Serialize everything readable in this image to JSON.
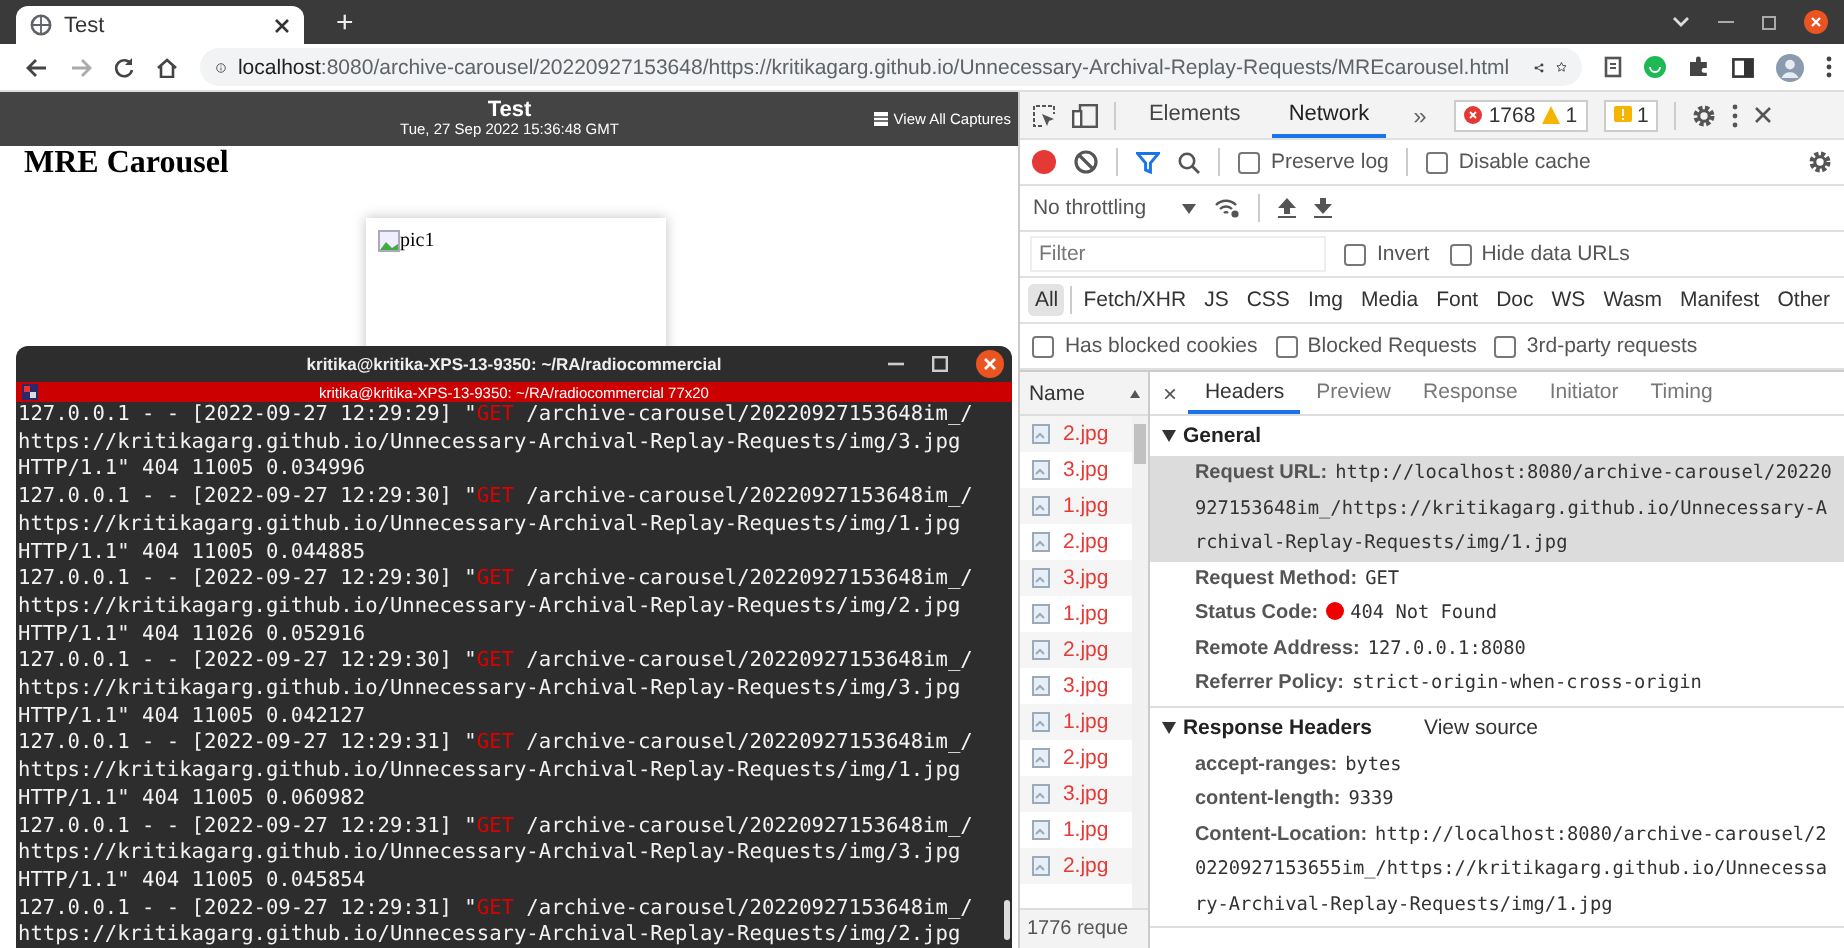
{
  "browser": {
    "tab": {
      "title": "Test"
    },
    "new_tab": "+",
    "address": {
      "host": "localhost",
      "path": ":8080/archive-carousel/20220927153648/https://kritikagarg.github.io/Unnecessary-Archival-Replay-Requests/MREcarousel.html"
    }
  },
  "page": {
    "banner": {
      "title": "Test",
      "date": "Tue, 27 Sep 2022 15:36:48 GMT",
      "link": "View All Captures"
    },
    "heading": "MRE Carousel",
    "image_alt": "pic1"
  },
  "terminal": {
    "title": "kritika@kritika-XPS-13-9350: ~/RA/radiocommercial",
    "subtitle": "kritika@kritika-XPS-13-9350: ~/RA/radiocommercial 77x20",
    "entries": [
      {
        "start": "127.0.0.1 - - [2022-09-27 12:29:29] \"",
        "method": "GET",
        "rest": " /archive-carousel/20220927153648im_/",
        "url": "https://kritikagarg.github.io/Unnecessary-Archival-Replay-Requests/img/3.jpg",
        "tail": "HTTP/1.1\" 404 11005 0.034996"
      },
      {
        "start": "127.0.0.1 - - [2022-09-27 12:29:30] \"",
        "method": "GET",
        "rest": " /archive-carousel/20220927153648im_/",
        "url": "https://kritikagarg.github.io/Unnecessary-Archival-Replay-Requests/img/1.jpg",
        "tail": "HTTP/1.1\" 404 11005 0.044885"
      },
      {
        "start": "127.0.0.1 - - [2022-09-27 12:29:30] \"",
        "method": "GET",
        "rest": " /archive-carousel/20220927153648im_/",
        "url": "https://kritikagarg.github.io/Unnecessary-Archival-Replay-Requests/img/2.jpg",
        "tail": "HTTP/1.1\" 404 11026 0.052916"
      },
      {
        "start": "127.0.0.1 - - [2022-09-27 12:29:30] \"",
        "method": "GET",
        "rest": " /archive-carousel/20220927153648im_/",
        "url": "https://kritikagarg.github.io/Unnecessary-Archival-Replay-Requests/img/3.jpg",
        "tail": "HTTP/1.1\" 404 11005 0.042127"
      },
      {
        "start": "127.0.0.1 - - [2022-09-27 12:29:31] \"",
        "method": "GET",
        "rest": " /archive-carousel/20220927153648im_/",
        "url": "https://kritikagarg.github.io/Unnecessary-Archival-Replay-Requests/img/1.jpg",
        "tail": "HTTP/1.1\" 404 11005 0.060982"
      },
      {
        "start": "127.0.0.1 - - [2022-09-27 12:29:31] \"",
        "method": "GET",
        "rest": " /archive-carousel/20220927153648im_/",
        "url": "https://kritikagarg.github.io/Unnecessary-Archival-Replay-Requests/img/3.jpg",
        "tail": "HTTP/1.1\" 404 11005 0.045854"
      },
      {
        "start": "127.0.0.1 - - [2022-09-27 12:29:31] \"",
        "method": "GET",
        "rest": " /archive-carousel/20220927153648im_/",
        "url": "https://kritikagarg.github.io/Unnecessary-Archival-Replay-Requests/img/2.jpg"
      }
    ]
  },
  "devtools": {
    "panel_tabs": [
      {
        "label": "Elements",
        "selected": false
      },
      {
        "label": "Network",
        "selected": true
      }
    ],
    "more": "»",
    "errors": "1768",
    "warnings": "1",
    "issues": "1",
    "checkboxes": [
      {
        "label": "Preserve log",
        "checked": false
      },
      {
        "label": "Disable cache",
        "checked": false
      }
    ],
    "throttling": "No throttling",
    "filter": {
      "placeholder": "Filter"
    },
    "filter_options": [
      {
        "label": "Invert",
        "checked": false
      },
      {
        "label": "Hide data URLs",
        "checked": false
      }
    ],
    "types": [
      {
        "label": "All",
        "selected": true
      },
      {
        "label": "Fetch/XHR",
        "selected": false
      },
      {
        "label": "JS",
        "selected": false
      },
      {
        "label": "CSS",
        "selected": false
      },
      {
        "label": "Img",
        "selected": false
      },
      {
        "label": "Media",
        "selected": false
      },
      {
        "label": "Font",
        "selected": false
      },
      {
        "label": "Doc",
        "selected": false
      },
      {
        "label": "WS",
        "selected": false
      },
      {
        "label": "Wasm",
        "selected": false
      },
      {
        "label": "Manifest",
        "selected": false
      },
      {
        "label": "Other",
        "selected": false
      }
    ],
    "blocked_options": [
      {
        "label": "Has blocked cookies",
        "checked": false
      },
      {
        "label": "Blocked Requests",
        "checked": false
      },
      {
        "label": "3rd-party requests",
        "checked": false
      }
    ],
    "requests": {
      "header": "Name",
      "items": [
        {
          "name": "2.jpg"
        },
        {
          "name": "3.jpg"
        },
        {
          "name": "1.jpg"
        },
        {
          "name": "2.jpg"
        },
        {
          "name": "3.jpg"
        },
        {
          "name": "1.jpg"
        },
        {
          "name": "2.jpg"
        },
        {
          "name": "3.jpg"
        },
        {
          "name": "1.jpg"
        },
        {
          "name": "2.jpg"
        },
        {
          "name": "3.jpg"
        },
        {
          "name": "1.jpg"
        },
        {
          "name": "2.jpg"
        }
      ],
      "footer": "1776 reque"
    },
    "detail": {
      "close": "×",
      "tabs": [
        {
          "label": "Headers",
          "selected": true
        },
        {
          "label": "Preview",
          "selected": false
        },
        {
          "label": "Response",
          "selected": false
        },
        {
          "label": "Initiator",
          "selected": false
        },
        {
          "label": "Timing",
          "selected": false
        }
      ],
      "sections": [
        {
          "title": "General",
          "expanded": true,
          "rows": [
            {
              "label": "Request URL:",
              "value": "http://localhost:8080/archive-carousel/20220927153648im_/https://kritikagarg.github.io/Unnecessary-Archival-Replay-Requests/img/1.jpg",
              "highlighted": true,
              "kind": "text"
            },
            {
              "label": "Request Method:",
              "value": "GET",
              "highlighted": false,
              "kind": "text"
            },
            {
              "label": "Status Code:",
              "value": "404 Not Found",
              "highlighted": false,
              "kind": "status"
            },
            {
              "label": "Remote Address:",
              "value": "127.0.0.1:8080",
              "highlighted": false,
              "kind": "text"
            },
            {
              "label": "Referrer Policy:",
              "value": "strict-origin-when-cross-origin",
              "highlighted": false,
              "kind": "text"
            }
          ]
        },
        {
          "title": "Response Headers",
          "expanded": true,
          "link": "View source",
          "rows": [
            {
              "label": "accept-ranges:",
              "value": "bytes",
              "highlighted": false,
              "kind": "text"
            },
            {
              "label": "content-length:",
              "value": "9339",
              "highlighted": false,
              "kind": "text"
            },
            {
              "label": "Content-Location:",
              "value": "http://localhost:8080/archive-carousel/20220927153655im_/https://kritikagarg.github.io/Unnecessary-Archival-Replay-Requests/img/1.jpg",
              "highlighted": false,
              "kind": "text"
            }
          ]
        }
      ]
    }
  }
}
